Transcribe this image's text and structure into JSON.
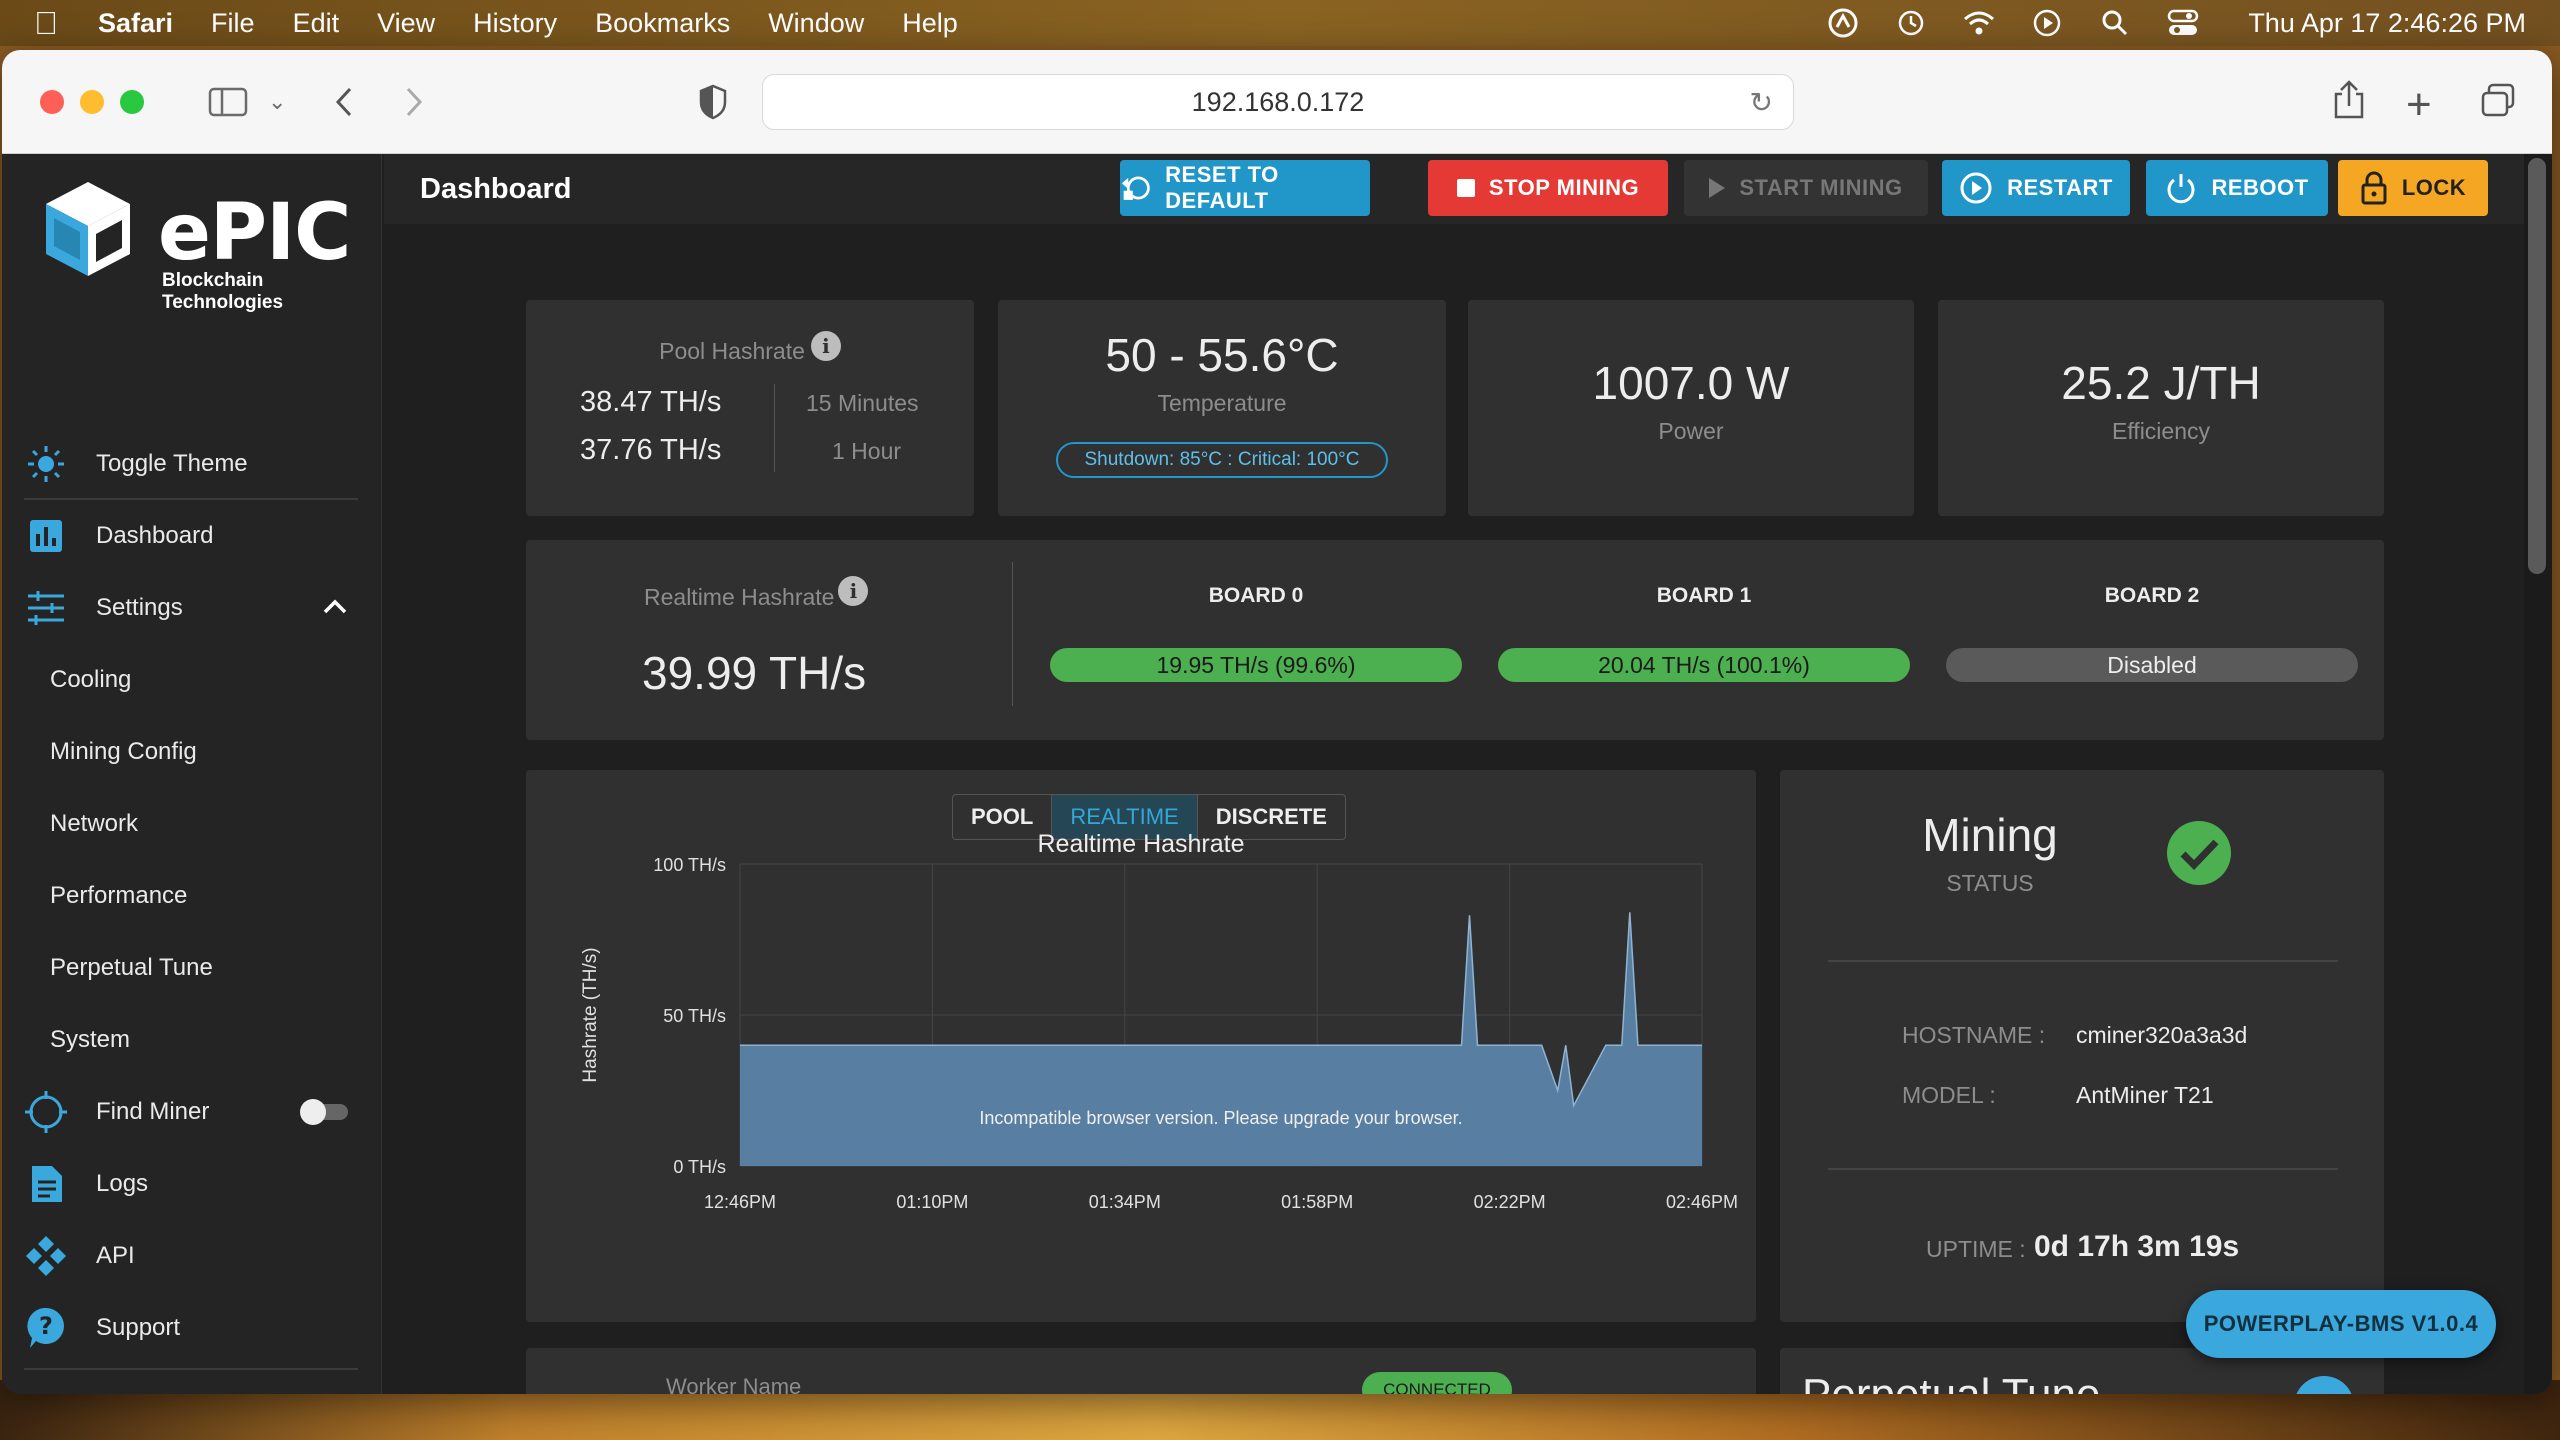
{
  "menubar": {
    "app_name": "Safari",
    "items": [
      "File",
      "Edit",
      "View",
      "History",
      "Bookmarks",
      "Window",
      "Help"
    ],
    "clock": "Thu Apr 17  2:46:26 PM"
  },
  "browser": {
    "url": "192.168.0.172"
  },
  "sidebar": {
    "logo_text": "ePIC",
    "logo_sub": "Blockchain Technologies",
    "toggle_theme": "Toggle Theme",
    "dashboard": "Dashboard",
    "settings": "Settings",
    "settings_items": [
      "Cooling",
      "Mining Config",
      "Network",
      "Performance",
      "Perpetual Tune",
      "System"
    ],
    "find_miner": "Find Miner",
    "logs": "Logs",
    "api": "API",
    "support": "Support"
  },
  "header": {
    "title": "Dashboard",
    "buttons": {
      "reset": "RESET TO DEFAULT",
      "stop": "STOP MINING",
      "start": "START MINING",
      "restart": "RESTART",
      "reboot": "REBOOT",
      "lock": "LOCK"
    }
  },
  "stats": {
    "pool_hashrate_label": "Pool Hashrate",
    "pool_15m_value": "38.47 TH/s",
    "pool_15m_label": "15 Minutes",
    "pool_1h_value": "37.76 TH/s",
    "pool_1h_label": "1 Hour",
    "temperature_value": "50 - 55.6°C",
    "temperature_label": "Temperature",
    "temperature_limits": "Shutdown: 85°C : Critical: 100°C",
    "power_value": "1007.0 W",
    "power_label": "Power",
    "efficiency_value": "25.2 J/TH",
    "efficiency_label": "Efficiency"
  },
  "realtime": {
    "label": "Realtime Hashrate",
    "value": "39.99 TH/s",
    "boards": [
      {
        "name": "BOARD 0",
        "value": "19.95 TH/s (99.6%)",
        "status": "ok"
      },
      {
        "name": "BOARD 1",
        "value": "20.04 TH/s (100.1%)",
        "status": "ok"
      },
      {
        "name": "BOARD 2",
        "value": "Disabled",
        "status": "disabled"
      }
    ]
  },
  "chart_tabs": {
    "pool": "POOL",
    "realtime": "REALTIME",
    "discrete": "DISCRETE",
    "active": "REALTIME"
  },
  "chart_data": {
    "type": "area",
    "title": "Realtime Hashrate",
    "ylabel": "Hashrate (TH/s)",
    "xlabel": "",
    "ylim": [
      0,
      100
    ],
    "y_ticks": [
      "100 TH/s",
      "50 TH/s",
      "0 TH/s"
    ],
    "x_ticks": [
      "12:46PM",
      "01:10PM",
      "01:34PM",
      "01:58PM",
      "02:22PM",
      "02:46PM"
    ],
    "grid": true,
    "fill_color": "#5b84a8",
    "series": [
      {
        "x": [
          "12:46PM",
          "01:10PM",
          "01:34PM",
          "01:58PM",
          "02:14PM",
          "02:16PM",
          "02:17PM",
          "02:18PM",
          "02:22PM",
          "02:26PM",
          "02:28PM",
          "02:29PM",
          "02:30PM",
          "02:34PM",
          "02:36PM",
          "02:37PM",
          "02:38PM",
          "02:46PM"
        ],
        "values": [
          40,
          40,
          40,
          40,
          40,
          40,
          83,
          40,
          40,
          40,
          25,
          40,
          20,
          40,
          40,
          84,
          40,
          40
        ]
      }
    ],
    "annotation": "Incompatible browser version. Please upgrade your browser."
  },
  "mining_status": {
    "title": "Mining",
    "subtitle": "STATUS",
    "hostname_label": "HOSTNAME :",
    "hostname_value": "cminer320a3a3d",
    "model_label": "MODEL :",
    "model_value": "AntMiner T21",
    "uptime_label": "UPTIME :",
    "uptime_value": "0d 17h 3m 19s",
    "status_color": "#4caf50"
  },
  "bottom_cards": {
    "worker_name": "Worker Name",
    "connected": "CONNECTED",
    "perpetual_tune": "Perpetual Tune"
  },
  "powerplay": "POWERPLAY-BMS V1.0.4",
  "colors": {
    "accent": "#2196c9",
    "danger": "#e53935",
    "warning": "#f5a623",
    "success": "#4caf50"
  }
}
